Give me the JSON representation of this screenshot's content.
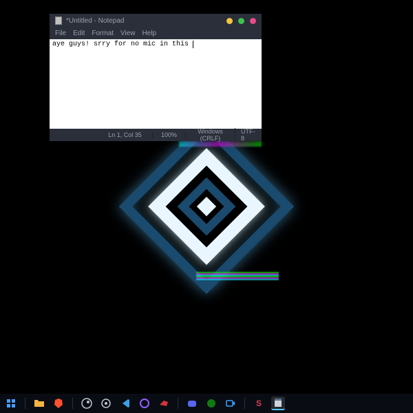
{
  "notepad": {
    "title": "*Untitled - Notepad",
    "menu": {
      "file": "File",
      "edit": "Edit",
      "format": "Format",
      "view": "View",
      "help": "Help"
    },
    "content": "aye guys! srry for no mic in this ",
    "status": {
      "position": "Ln 1, Col 35",
      "zoom": "100%",
      "line_ending": "Windows (CRLF)",
      "encoding": "UTF-8"
    }
  },
  "taskbar": {
    "items": [
      {
        "name": "start",
        "color": "#4a9eff"
      },
      {
        "name": "file-explorer",
        "color": "#f5b544"
      },
      {
        "name": "brave-browser",
        "color": "#ff5030"
      },
      {
        "name": "steam",
        "color": "#c0c6d0"
      },
      {
        "name": "epic-games",
        "color": "#c0c6d0"
      },
      {
        "name": "vscode",
        "color": "#3ba0e6"
      },
      {
        "name": "app-purple",
        "color": "#9060ff"
      },
      {
        "name": "riot-games",
        "color": "#d13639"
      },
      {
        "name": "discord",
        "color": "#5865f2"
      },
      {
        "name": "xbox",
        "color": "#107c10"
      },
      {
        "name": "screen-recorder",
        "color": "#3aa0ff"
      },
      {
        "name": "app-s",
        "color": "#d04050",
        "letter": "S"
      },
      {
        "name": "notepad",
        "color": "#c0c6d0",
        "active": true
      }
    ]
  }
}
